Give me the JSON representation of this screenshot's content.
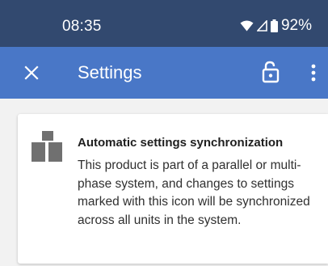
{
  "status_bar": {
    "time": "08:35",
    "battery": "92%",
    "icons": [
      "wifi-icon",
      "cell-signal-icon",
      "battery-icon"
    ]
  },
  "app_bar": {
    "title": "Settings",
    "icons": [
      "close-icon",
      "lock-open-icon",
      "more-vert-icon"
    ]
  },
  "card": {
    "icon": "sync-units-icon",
    "title": "Automatic settings synchronization",
    "body": "This product is part of a parallel or multi-phase system, and changes to settings marked with this icon will be synchronized across all units in the system."
  },
  "colors": {
    "status_bar": "#32496f",
    "app_bar": "#4977c7",
    "icon_grey": "#707070",
    "background": "#f2f2f2"
  }
}
